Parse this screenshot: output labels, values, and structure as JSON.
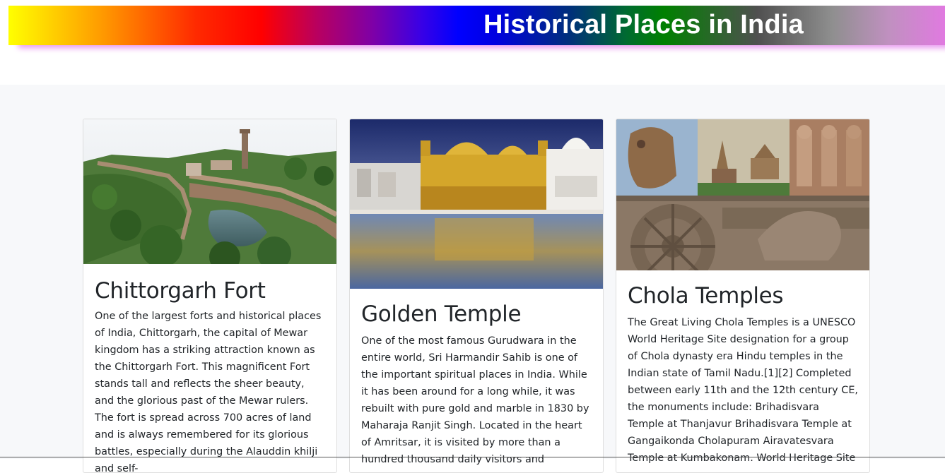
{
  "header": {
    "title": "Historical Places in India"
  },
  "cards": [
    {
      "title": "Chittorgarh Fort",
      "image_alt": "Chittorgarh Fort",
      "text": "One of the largest forts and historical places of India, Chittorgarh, the capital of Mewar kingdom has a striking attraction known as the Chittorgarh Fort. This magnificent Fort stands tall and reflects the sheer beauty, and the glorious past of the Mewar rulers. The fort is spread across 700 acres of land and is always remembered for its glorious battles, especially during the Alauddin khilji and self-"
    },
    {
      "title": "Golden Temple",
      "image_alt": "Golden Temple",
      "text": "One of the most famous Gurudwara in the entire world, Sri Harmandir Sahib is one of the important spiritual places in India. While it has been around for a long while, it was rebuilt with pure gold and marble in 1830 by Maharaja Ranjit Singh. Located in the heart of Amritsar, it is visited by more than a hundred thousand daily visitors and"
    },
    {
      "title": "Chola Temples",
      "image_alt": "Chola Temples",
      "text": "The Great Living Chola Temples is a UNESCO World Heritage Site designation for a group of Chola dynasty era Hindu temples in the Indian state of Tamil Nadu.[1][2] Completed between early 11th and the 12th century CE, the monuments include: Brihadisvara Temple at Thanjavur Brihadisvara Temple at Gangaikonda Cholapuram Airavatesvara Temple at Kumbakonam. World Heritage Site"
    }
  ],
  "colors": {
    "page_bg": "#f7f8fa",
    "card_border": "#dedede",
    "text": "#212529"
  }
}
